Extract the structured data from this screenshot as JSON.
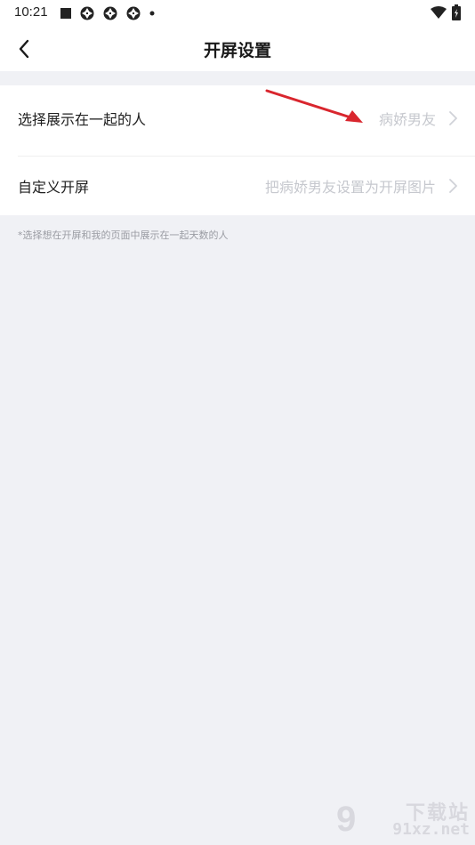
{
  "status_bar": {
    "time": "10:21",
    "left_icons": [
      "stop-square-icon",
      "aperture-icon",
      "aperture-icon",
      "aperture-icon",
      "dot-icon"
    ],
    "right_icons": [
      "wifi-icon",
      "battery-icon"
    ]
  },
  "nav": {
    "title": "开屏设置",
    "back_icon": "chevron-left-icon"
  },
  "settings": {
    "rows": [
      {
        "label": "选择展示在一起的人",
        "value": "病娇男友"
      },
      {
        "label": "自定义开屏",
        "value": "把病娇男友设置为开屏图片"
      }
    ]
  },
  "hint": "*选择想在开屏和我的页面中展示在一起天数的人",
  "watermark": {
    "brand": "下载站",
    "domain": "91xz.net",
    "logo": "9"
  },
  "colors": {
    "background": "#f0f1f5",
    "card": "#ffffff",
    "value_text": "#c6c8ce",
    "hint_text": "#9a9ca3",
    "annotation_arrow": "#d9262e"
  }
}
